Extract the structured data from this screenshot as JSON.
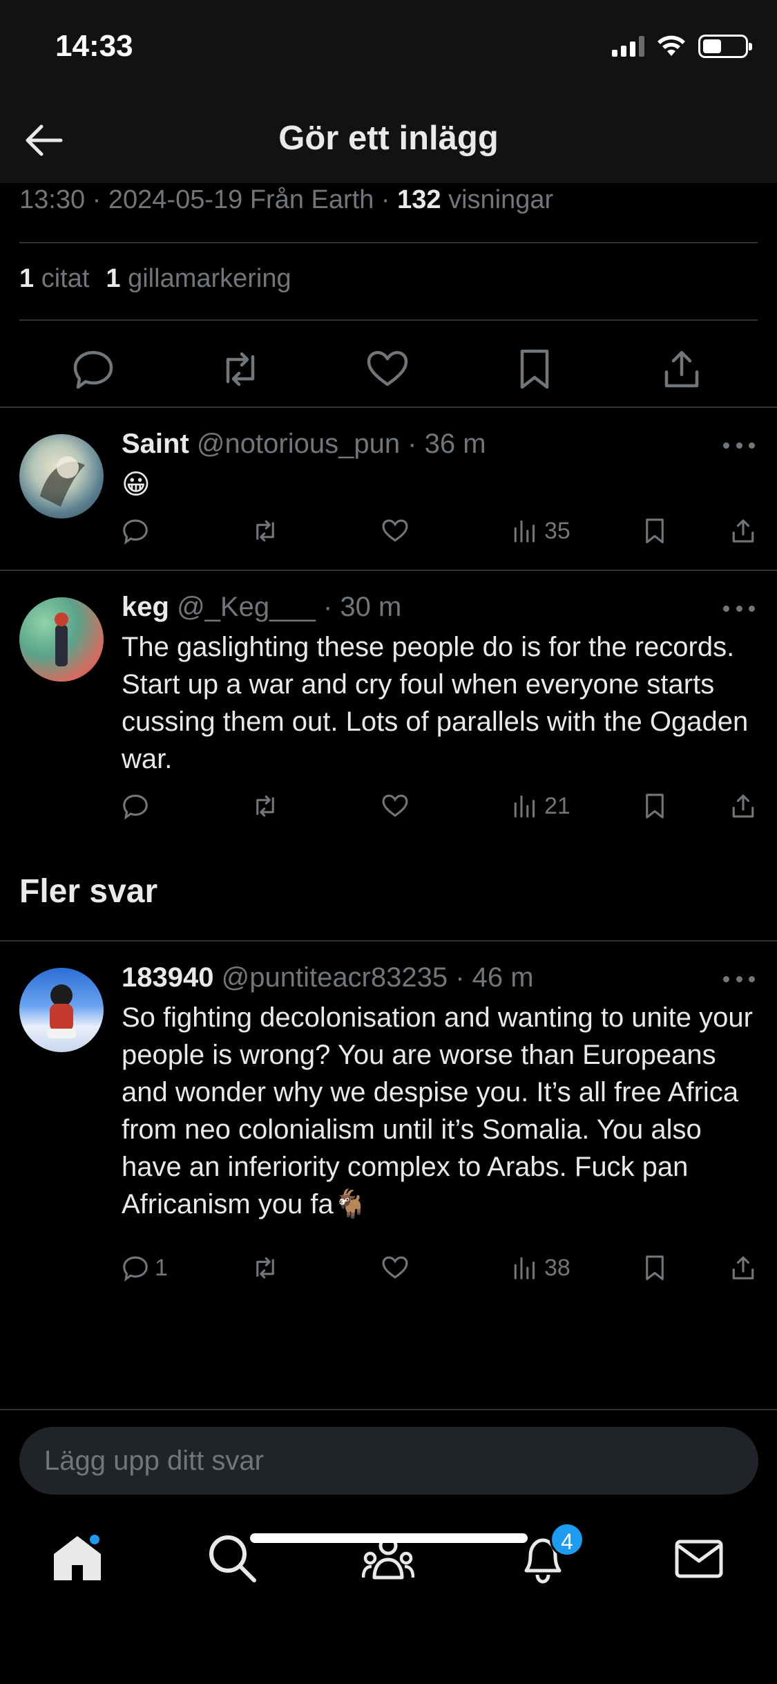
{
  "status_bar": {
    "time": "14:33"
  },
  "header": {
    "title": "Gör ett inlägg"
  },
  "post_meta": {
    "time": "13:30",
    "date": "2024-05-19",
    "source": "Från Earth",
    "views_count": "132",
    "views_label": "visningar"
  },
  "post_stats": {
    "quotes_count": "1",
    "quotes_label": "citat",
    "likes_count": "1",
    "likes_label": "gillamarkering"
  },
  "replies": [
    {
      "name": "Saint",
      "handle": "@notorious_pun",
      "time": "36 m",
      "text": "😀",
      "reply_count": "",
      "views": "35"
    },
    {
      "name": "keg",
      "handle": "@_Keg___",
      "time": "30 m",
      "text": "The gaslighting these people do is for the records. Start up a war and cry foul when everyone starts cussing them out. Lots of parallels with the Ogaden war.",
      "reply_count": "",
      "views": "21"
    }
  ],
  "more_replies": {
    "title": "Fler svar",
    "items": [
      {
        "name": "183940",
        "handle": "@puntiteacr83235",
        "time": "46 m",
        "text": "So fighting decolonisation and wanting to unite your people is wrong? You are worse than Europeans and wonder why we despise you. It’s all free Africa from neo colonialism until it’s Somalia. You also have an inferiority complex to Arabs. Fuck pan Africanism you fa🐐",
        "reply_count": "1",
        "views": "38"
      }
    ]
  },
  "reply_box": {
    "placeholder": "Lägg upp ditt svar"
  },
  "bottom_nav": {
    "notifications_badge": "4"
  },
  "colors": {
    "accent": "#1d9bf0",
    "background": "#000000",
    "secondary_text": "#71767b",
    "divider": "#2f3336"
  }
}
